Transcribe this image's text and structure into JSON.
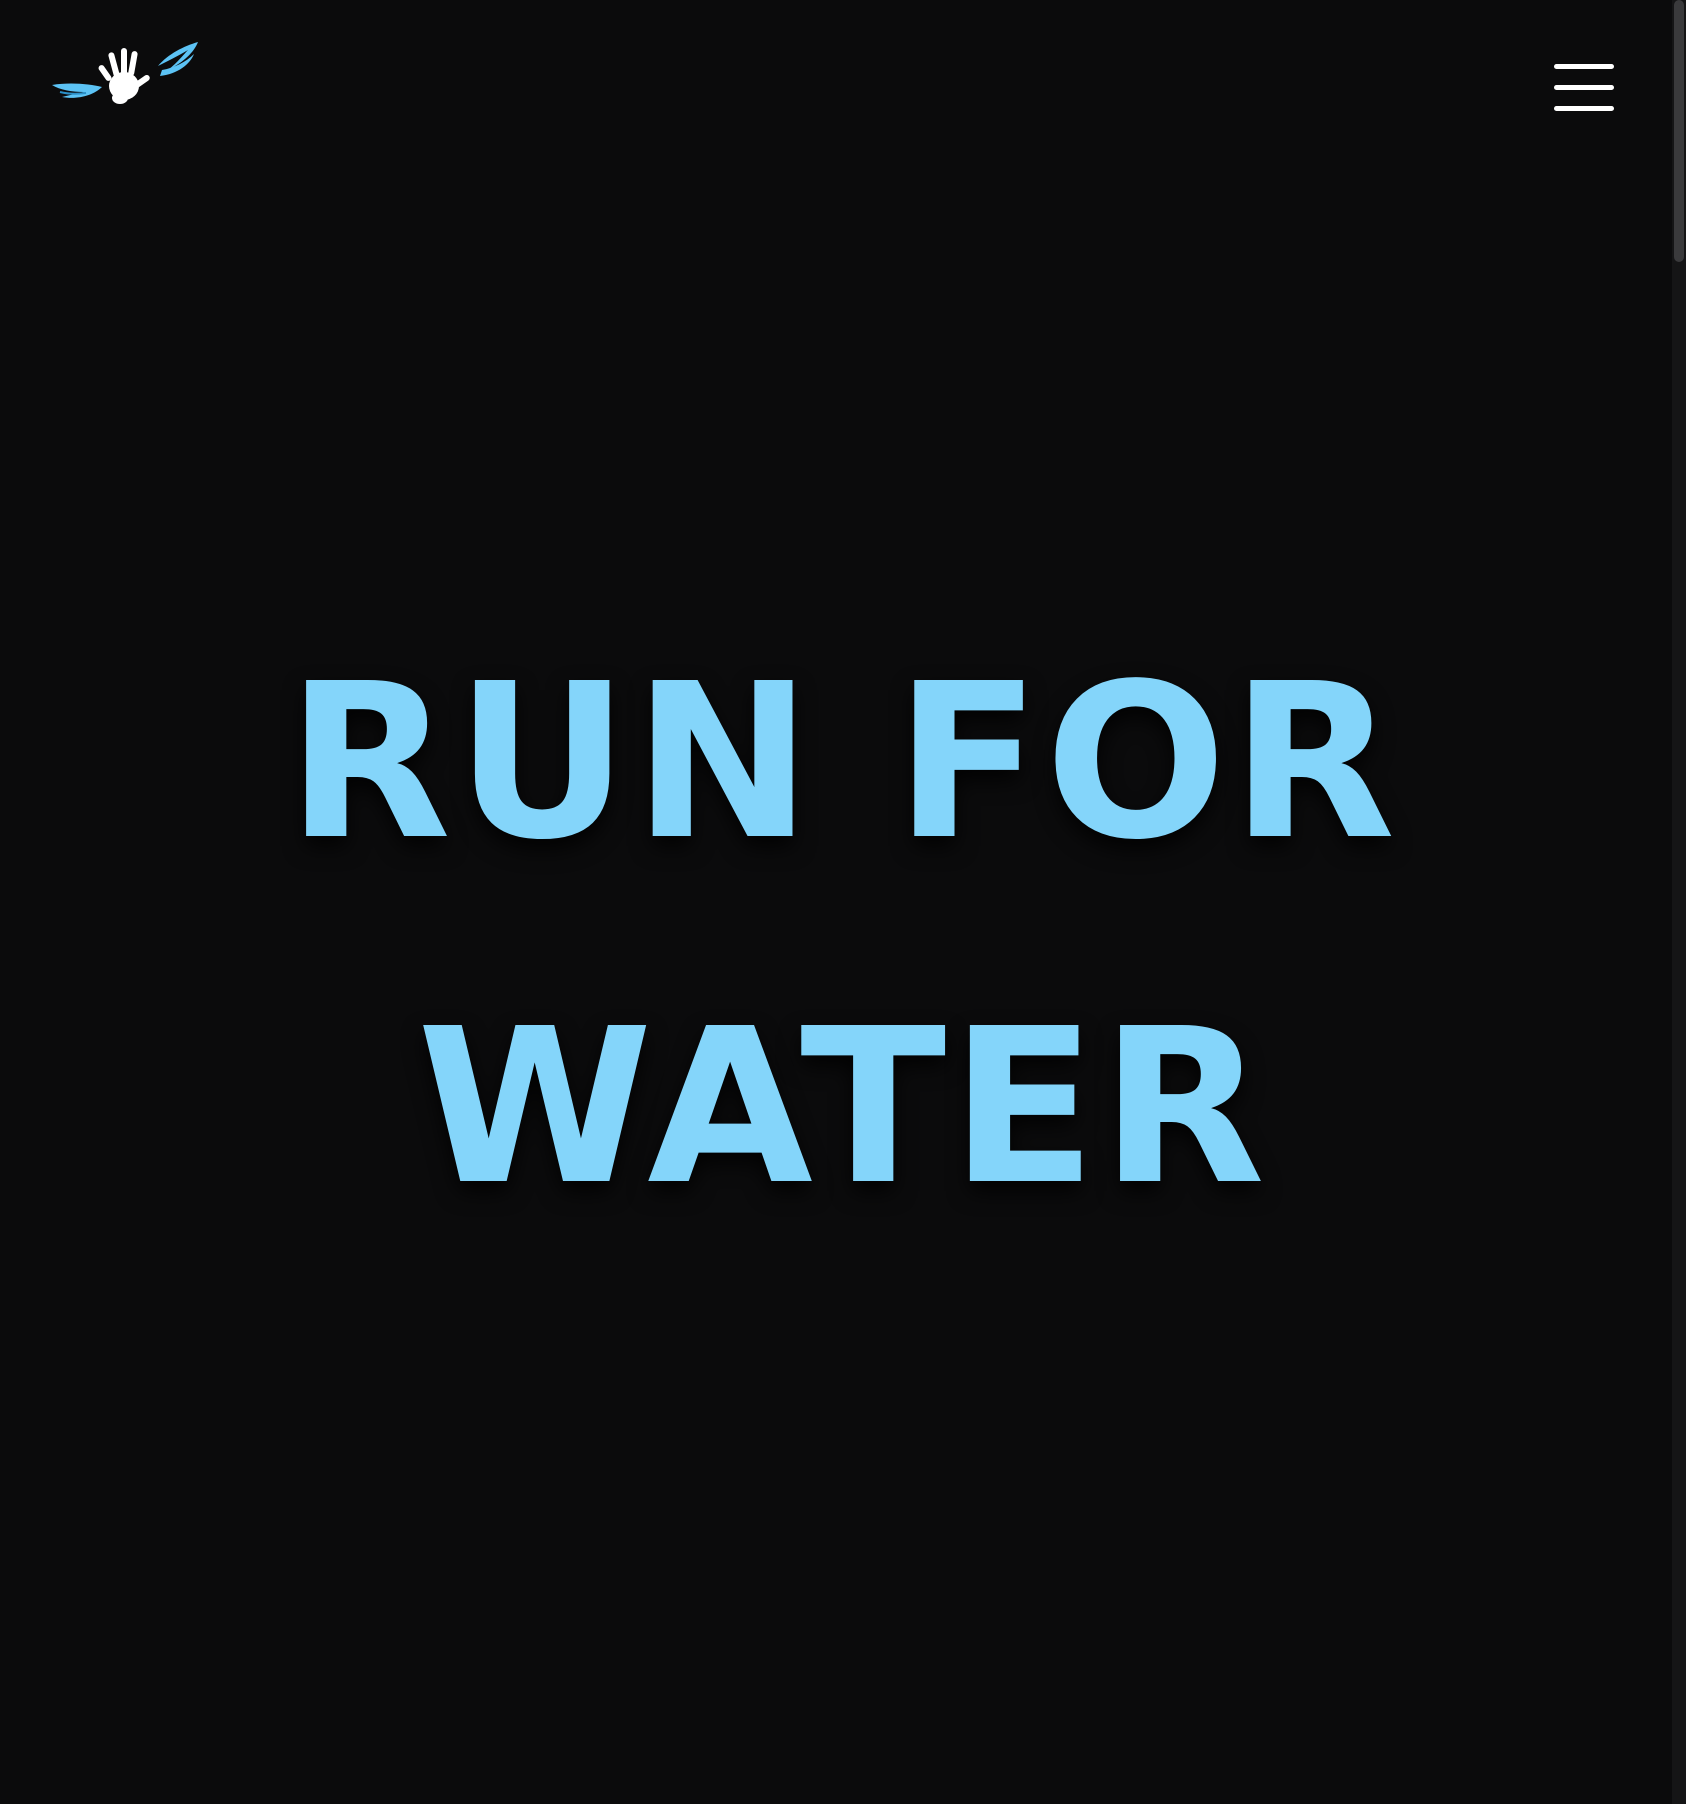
{
  "header": {
    "logo_icon": "winged-hand-logo-icon",
    "menu_icon": "hamburger-menu-icon"
  },
  "hero": {
    "line1": "RUN FOR",
    "line2": "WATER"
  },
  "colors": {
    "background": "#0b0b0c",
    "accent": "#84d5fa",
    "logo_wing": "#5cc3f5",
    "menu": "#ffffff"
  }
}
